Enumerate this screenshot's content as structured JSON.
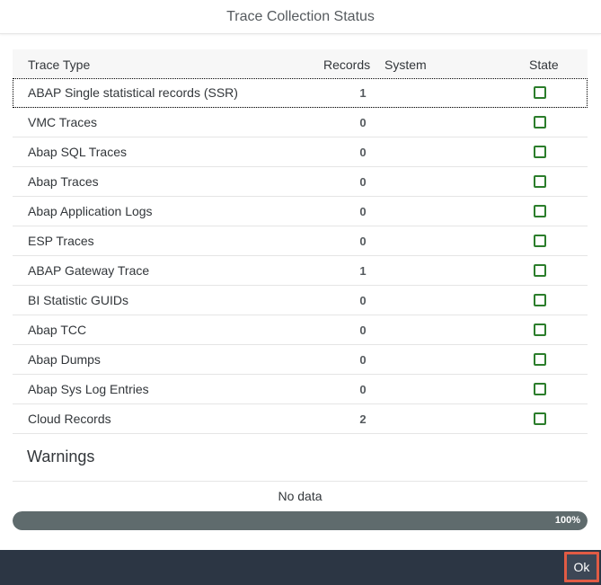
{
  "dialog": {
    "title": "Trace Collection Status"
  },
  "table": {
    "headers": {
      "trace_type": "Trace Type",
      "records": "Records",
      "system": "System",
      "state": "State"
    },
    "rows": [
      {
        "trace_type": "ABAP Single statistical records (SSR)",
        "records": "1",
        "system": ""
      },
      {
        "trace_type": "VMC Traces",
        "records": "0",
        "system": ""
      },
      {
        "trace_type": "Abap SQL Traces",
        "records": "0",
        "system": ""
      },
      {
        "trace_type": "Abap Traces",
        "records": "0",
        "system": ""
      },
      {
        "trace_type": "Abap Application Logs",
        "records": "0",
        "system": ""
      },
      {
        "trace_type": "ESP Traces",
        "records": "0",
        "system": ""
      },
      {
        "trace_type": "ABAP Gateway Trace",
        "records": "1",
        "system": ""
      },
      {
        "trace_type": "BI Statistic GUIDs",
        "records": "0",
        "system": ""
      },
      {
        "trace_type": "Abap TCC",
        "records": "0",
        "system": ""
      },
      {
        "trace_type": "Abap Dumps",
        "records": "0",
        "system": ""
      },
      {
        "trace_type": "Abap Sys Log Entries",
        "records": "0",
        "system": ""
      },
      {
        "trace_type": "Cloud Records",
        "records": "2",
        "system": ""
      }
    ]
  },
  "warnings": {
    "title": "Warnings",
    "empty_text": "No data"
  },
  "progress": {
    "value": 100,
    "label": "100%"
  },
  "footer": {
    "ok_label": "Ok"
  },
  "colors": {
    "footer_bg": "#2c3644",
    "progress_fill": "#5f6b6d",
    "state_checkbox_border": "#2b7d2b",
    "ok_button_highlight": "#e15b44"
  }
}
